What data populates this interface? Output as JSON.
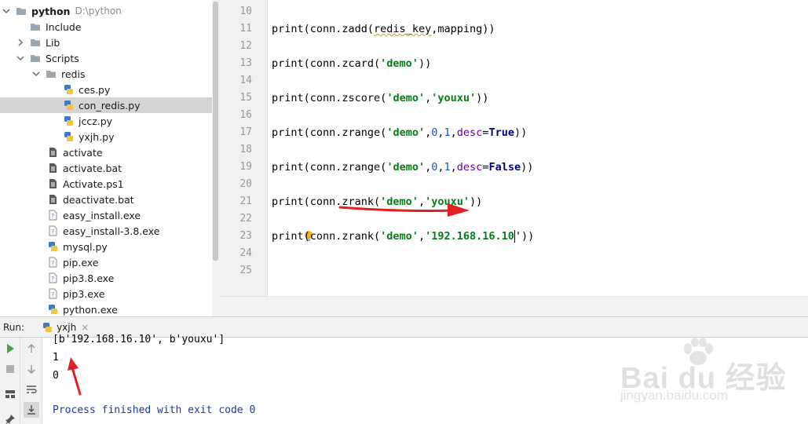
{
  "project_tree": {
    "root": {
      "label": "python",
      "path": "D:\\python"
    },
    "items": [
      {
        "label": "Include",
        "kind": "folder",
        "level": 1,
        "expanded": false,
        "has_arrow": false
      },
      {
        "label": "Lib",
        "kind": "folder",
        "level": 1,
        "expanded": false,
        "has_arrow": true
      },
      {
        "label": "Scripts",
        "kind": "folder",
        "level": 1,
        "expanded": true,
        "has_arrow": true
      },
      {
        "label": "redis",
        "kind": "folder",
        "level": 2,
        "expanded": true,
        "has_arrow": true
      },
      {
        "label": "ces.py",
        "kind": "py",
        "level": 3
      },
      {
        "label": "con_redis.py",
        "kind": "py",
        "level": 3,
        "selected": true
      },
      {
        "label": "jccz.py",
        "kind": "py",
        "level": 3
      },
      {
        "label": "yxjh.py",
        "kind": "py",
        "level": 3
      },
      {
        "label": "activate",
        "kind": "file",
        "level": 2
      },
      {
        "label": "activate.bat",
        "kind": "file",
        "level": 2
      },
      {
        "label": "Activate.ps1",
        "kind": "file",
        "level": 2
      },
      {
        "label": "deactivate.bat",
        "kind": "file",
        "level": 2
      },
      {
        "label": "easy_install.exe",
        "kind": "exe",
        "level": 2
      },
      {
        "label": "easy_install-3.8.exe",
        "kind": "exe",
        "level": 2
      },
      {
        "label": "mysql.py",
        "kind": "py",
        "level": 2
      },
      {
        "label": "pip.exe",
        "kind": "exe",
        "level": 2
      },
      {
        "label": "pip3.8.exe",
        "kind": "exe",
        "level": 2
      },
      {
        "label": "pip3.exe",
        "kind": "exe",
        "level": 2
      },
      {
        "label": "python.exe",
        "kind": "exe",
        "level": 2
      }
    ]
  },
  "editor": {
    "line_numbers": [
      "10",
      "11",
      "12",
      "13",
      "14",
      "15",
      "16",
      "17",
      "18",
      "19",
      "20",
      "21",
      "22",
      "23",
      "24",
      "25"
    ],
    "current_line": "23",
    "code": {
      "l11": {
        "a": "print(conn.zadd(",
        "b": "redis_key",
        "c": ",mapping))"
      },
      "l13": {
        "a": "print(conn.zcard(",
        "s1": "'demo'",
        "c": "))"
      },
      "l15": {
        "a": "print(conn.zscore(",
        "s1": "'demo'",
        "sep": ",",
        "s2": "'youxu'",
        "c": "))"
      },
      "l17": {
        "a": "print(conn.zrange(",
        "s1": "'demo'",
        "sep": ",",
        "n1": "0",
        "sep2": ",",
        "n2": "1",
        "sep3": ",",
        "kw": "desc",
        "eq": "=",
        "v": "True",
        "c": "))"
      },
      "l19": {
        "a": "print(conn.zrange(",
        "s1": "'demo'",
        "sep": ",",
        "n1": "0",
        "sep2": ",",
        "n2": "1",
        "sep3": ",",
        "kw": "desc",
        "eq": "=",
        "v": "False",
        "c": "))"
      },
      "l21": {
        "a": "print(conn.zrank(",
        "s1": "'demo'",
        "sep": ",",
        "s2": "'youxu'",
        "c": "))"
      },
      "l23": {
        "a": "print(conn.zrank(",
        "s1": "'demo'",
        "sep": ",",
        "s2a": "'192.168.16.10",
        "s2b": "'",
        "c": "))"
      }
    }
  },
  "run_panel": {
    "label": "Run:",
    "tab_label": "yxjh",
    "tab_close": "×",
    "output_lines": [
      "[b'192.168.16.10', b'youxu']",
      "1",
      "0"
    ],
    "finish_message": "Process finished with exit code 0"
  },
  "watermark": {
    "main": "Bai du 经验",
    "sub": "jingyan.baidu.com"
  },
  "colors": {
    "string": "#067d17",
    "keyword": "#000080",
    "kwarg": "#660099",
    "number": "#1750eb",
    "annotation_arrow": "#e02020"
  }
}
